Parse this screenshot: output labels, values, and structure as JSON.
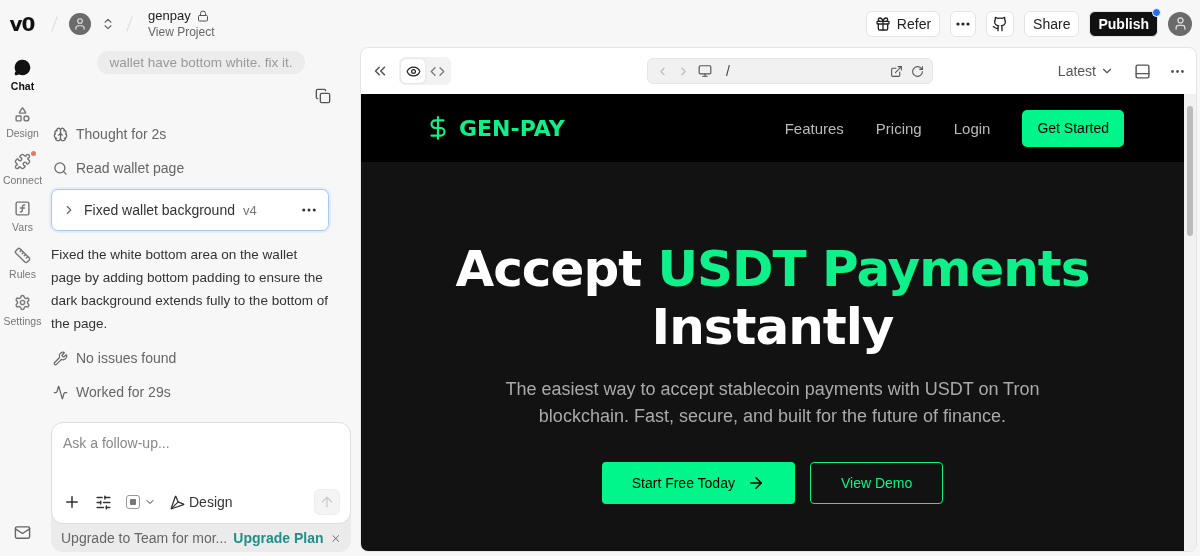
{
  "header": {
    "logo": "v0",
    "project": {
      "name": "genpay",
      "subtitle": "View Project",
      "locked": true
    },
    "actions": {
      "refer": "Refer",
      "share": "Share",
      "publish": "Publish",
      "publish_notice": true
    }
  },
  "rail": {
    "items": [
      {
        "label": "Chat",
        "selected": true,
        "badge": false
      },
      {
        "label": "Design",
        "selected": false,
        "badge": false
      },
      {
        "label": "Connect",
        "selected": false,
        "badge": true
      },
      {
        "label": "Vars",
        "selected": false,
        "badge": false
      },
      {
        "label": "Rules",
        "selected": false,
        "badge": false
      },
      {
        "label": "Settings",
        "selected": false,
        "badge": false
      }
    ]
  },
  "chat": {
    "user_message": "wallet have bottom white. fix it.",
    "steps": [
      {
        "kind": "thought",
        "text": "Thought for 2s"
      },
      {
        "kind": "read",
        "text": "Read wallet page"
      }
    ],
    "version_card": {
      "title": "Fixed wallet background",
      "version": "v4",
      "expanded": false
    },
    "summary": "Fixed the white bottom area on the wallet page by adding bottom padding to ensure the dark background extends fully to the bottom of the page.",
    "status": [
      {
        "kind": "check",
        "text": "No issues found"
      },
      {
        "kind": "work",
        "text": "Worked for 29s"
      }
    ],
    "composer": {
      "placeholder": "Ask a follow-up...",
      "mode": "Design"
    },
    "banner": {
      "text": "Upgrade to Team for mor...",
      "link": "Upgrade Plan"
    }
  },
  "preview": {
    "toolbar": {
      "modes": [
        {
          "kind": "preview",
          "selected": true
        },
        {
          "kind": "code",
          "selected": false
        }
      ],
      "path": "/",
      "version": "Latest"
    },
    "site": {
      "brand": "GEN-PAY",
      "nav": [
        "Features",
        "Pricing",
        "Login"
      ],
      "cta": "Get Started",
      "headline": [
        [
          {
            "text": "Accept ",
            "accent": false
          },
          {
            "text": "USDT Payments",
            "accent": true
          }
        ],
        [
          {
            "text": "Instantly",
            "accent": false
          }
        ]
      ],
      "subtitle": "The easiest way to accept stablecoin payments with USDT on Tron blockchain. Fast, secure, and built for the future of finance.",
      "primary": "Start Free Today",
      "secondary": "View Demo"
    }
  }
}
